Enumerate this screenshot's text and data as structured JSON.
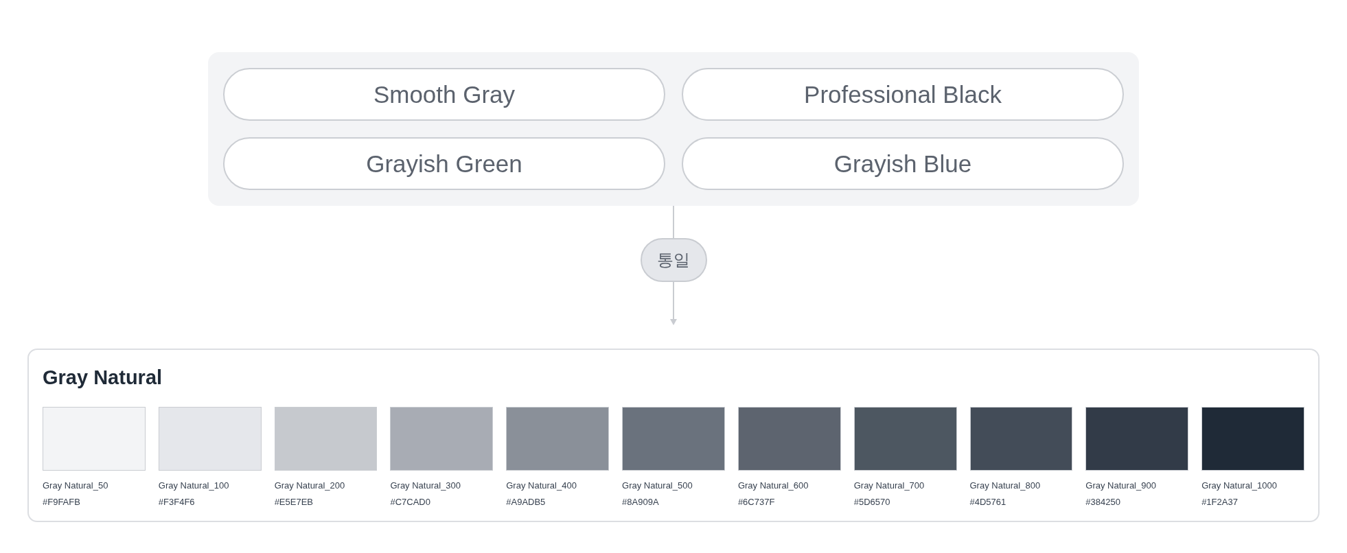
{
  "themes": [
    {
      "label": "Smooth Gray"
    },
    {
      "label": "Professional Black"
    },
    {
      "label": "Grayish Green"
    },
    {
      "label": "Grayish Blue"
    }
  ],
  "merge_label": "통일",
  "palette": {
    "title": "Gray Natural",
    "swatches": [
      {
        "name": "Gray Natural_50",
        "hex": "#F9FAFB",
        "color": "#f3f4f6"
      },
      {
        "name": "Gray Natural_100",
        "hex": "#F3F4F6",
        "color": "#e5e7eb"
      },
      {
        "name": "Gray Natural_200",
        "hex": "#E5E7EB",
        "color": "#c6c9ce"
      },
      {
        "name": "Gray Natural_300",
        "hex": "#C7CAD0",
        "color": "#a8acb4"
      },
      {
        "name": "Gray Natural_400",
        "hex": "#A9ADB5",
        "color": "#8a9099"
      },
      {
        "name": "Gray Natural_500",
        "hex": "#8A909A",
        "color": "#6a727d"
      },
      {
        "name": "Gray Natural_600",
        "hex": "#6C737F",
        "color": "#5d646f"
      },
      {
        "name": "Gray Natural_700",
        "hex": "#5D6570",
        "color": "#4d5761"
      },
      {
        "name": "Gray Natural_800",
        "hex": "#4D5761",
        "color": "#434c58"
      },
      {
        "name": "Gray Natural_900",
        "hex": "#384250",
        "color": "#323b48"
      },
      {
        "name": "Gray Natural_1000",
        "hex": "#1F2A37",
        "color": "#1f2a37"
      }
    ]
  }
}
